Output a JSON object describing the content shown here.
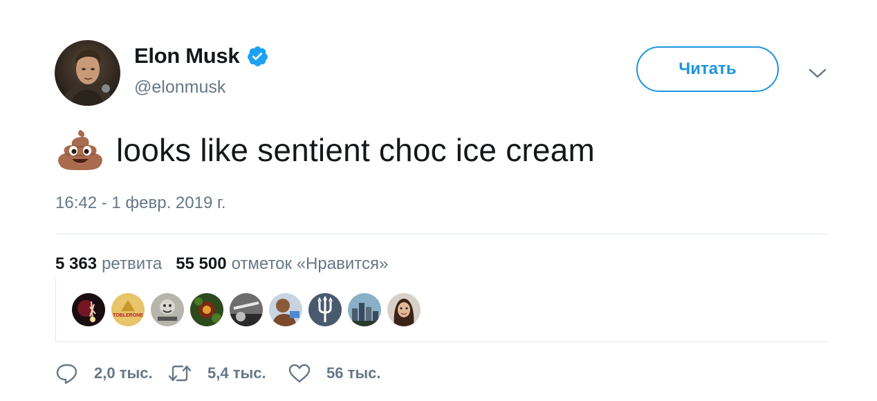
{
  "author": {
    "name": "Elon Musk",
    "handle": "@elonmusk",
    "verified": true
  },
  "follow_button": {
    "label": "Читать"
  },
  "tweet": {
    "emoji": "poo-emoji",
    "text": "looks like sentient choc ice cream",
    "timestamp": "16:42 - 1 февр. 2019 г."
  },
  "stats": {
    "retweets_count": "5 363",
    "retweets_label": "ретвита",
    "likes_count": "55 500",
    "likes_label": "отметок «Нравится»"
  },
  "likers": [
    {
      "icon": "fireworks-avatar"
    },
    {
      "icon": "toblerone-avatar",
      "text": "TOBLERONE"
    },
    {
      "icon": "meme-avatar"
    },
    {
      "icon": "flower-avatar"
    },
    {
      "icon": "bw-photo-avatar"
    },
    {
      "icon": "person-avatar"
    },
    {
      "icon": "trident-avatar"
    },
    {
      "icon": "city-avatar"
    },
    {
      "icon": "woman-avatar"
    }
  ],
  "actions": {
    "replies": "2,0 тыс.",
    "retweets": "5,4 тыс.",
    "likes": "56 тыс."
  },
  "colors": {
    "accent": "#1b95e0",
    "verified": "#1da1f2",
    "secondary_text": "#657786",
    "divider": "#e1e8ed"
  }
}
